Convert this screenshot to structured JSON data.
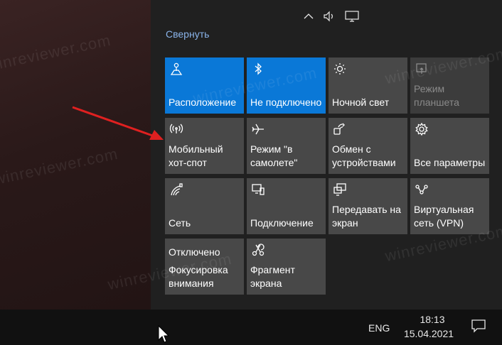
{
  "action_center": {
    "collapse_label": "Свернуть",
    "tiles": [
      {
        "name": "location",
        "label": "Расположение",
        "state": "active",
        "icon": "location-icon"
      },
      {
        "name": "bluetooth",
        "label": "Не подключено",
        "state": "active",
        "icon": "bluetooth-icon"
      },
      {
        "name": "night-light",
        "label": "Ночной свет",
        "state": "normal",
        "icon": "brightness-icon"
      },
      {
        "name": "tablet-mode",
        "label": "Режим планшета",
        "state": "disabled",
        "icon": "tablet-mode-icon"
      },
      {
        "name": "mobile-hotspot",
        "label": "Мобильный хот-спот",
        "state": "normal",
        "icon": "hotspot-icon"
      },
      {
        "name": "airplane-mode",
        "label": "Режим \"в самолете\"",
        "state": "normal",
        "icon": "airplane-icon"
      },
      {
        "name": "nearby-sharing",
        "label": "Обмен с устройствами",
        "state": "normal",
        "icon": "share-icon"
      },
      {
        "name": "all-settings",
        "label": "Все параметры",
        "state": "normal",
        "icon": "gear-icon"
      },
      {
        "name": "network",
        "label": "Сеть",
        "state": "normal",
        "icon": "network-icon"
      },
      {
        "name": "connect",
        "label": "Подключение",
        "state": "normal",
        "icon": "connect-icon"
      },
      {
        "name": "project",
        "label": "Передавать на экран",
        "state": "normal",
        "icon": "project-icon"
      },
      {
        "name": "vpn",
        "label": "Виртуальная сеть (VPN)",
        "state": "normal",
        "icon": "vpn-icon"
      },
      {
        "name": "focus-assist",
        "label": "Фокусировка внимания",
        "status": "Отключено",
        "state": "normal",
        "icon": "moon-icon"
      },
      {
        "name": "screen-snip",
        "label": "Фрагмент экрана",
        "state": "normal",
        "icon": "snip-icon"
      }
    ]
  },
  "taskbar": {
    "language": "ENG",
    "time": "18:13",
    "date": "15.04.2021"
  },
  "watermark": "winreviewer.com",
  "colors": {
    "accent": "#0a78d7",
    "tile": "#484848",
    "arrow": "#e02020"
  }
}
